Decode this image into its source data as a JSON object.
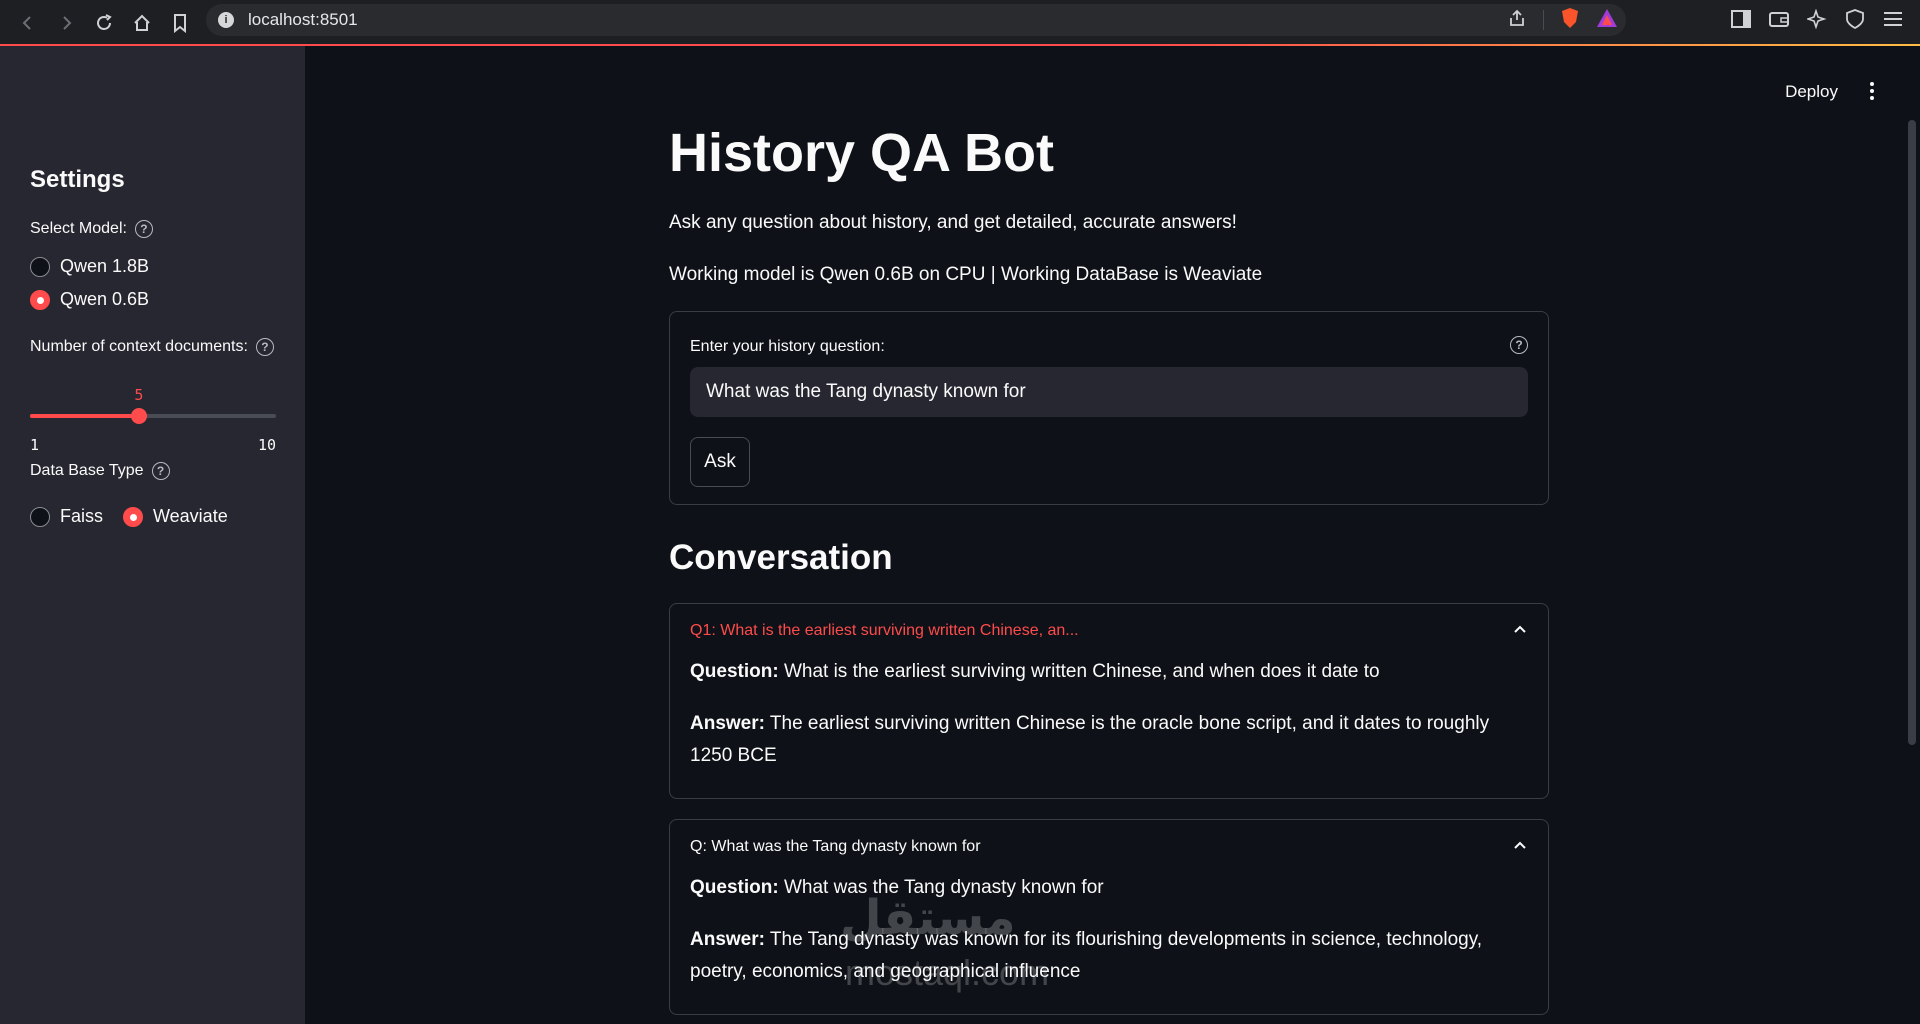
{
  "browser": {
    "url": "localhost:8501"
  },
  "sidebar": {
    "title": "Settings",
    "model_label": "Select Model:",
    "models": [
      {
        "label": "Qwen 1.8B",
        "selected": false
      },
      {
        "label": "Qwen 0.6B",
        "selected": true
      }
    ],
    "docs_label": "Number of context documents:",
    "docs_slider": {
      "value": "5",
      "min": "1",
      "max": "10"
    },
    "db_label": "Data Base Type",
    "db_options": [
      {
        "label": "Faiss",
        "selected": false
      },
      {
        "label": "Weaviate",
        "selected": true
      }
    ]
  },
  "header": {
    "deploy_label": "Deploy"
  },
  "main": {
    "title": "History QA Bot",
    "subtitle": "Ask any question about history, and get detailed, accurate answers!",
    "status": "Working model is Qwen 0.6B on CPU | Working DataBase is Weaviate",
    "form": {
      "label": "Enter your history question:",
      "input_value": "What was the Tang dynasty known for",
      "ask_label": "Ask"
    },
    "conversation_title": "Conversation",
    "entries": [
      {
        "header": "Q1: What is the earliest surviving written Chinese, an...",
        "question_label": "Question:",
        "question": "What is the earliest surviving written Chinese, and when does it date to",
        "answer_label": "Answer:",
        "answer": "The earliest surviving written Chinese is the oracle bone script, and it dates to roughly 1250 BCE"
      },
      {
        "header": "Q: What was the Tang dynasty known for",
        "question_label": "Question:",
        "question": "What was the Tang dynasty known for",
        "answer_label": "Answer:",
        "answer": "The Tang dynasty was known for its flourishing developments in science, technology, poetry, economics, and geographical influence"
      }
    ]
  },
  "watermark": {
    "arabic": "مستقل",
    "latin": "mostaql.com"
  },
  "colors": {
    "accent": "#ff4b4b",
    "background": "#0e1117",
    "sidebar": "#262730"
  }
}
